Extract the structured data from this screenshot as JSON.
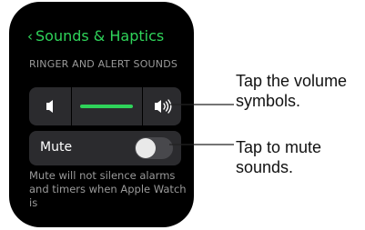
{
  "header": {
    "back_label": "Sounds & Haptics"
  },
  "section": {
    "label": "RINGER AND ALERT SOUNDS"
  },
  "volume": {
    "level": 0.5
  },
  "mute": {
    "label": "Mute",
    "state": "off"
  },
  "footnote": "Mute will not silence alarms and timers when Apple Watch is",
  "callouts": {
    "volume": "Tap the volume symbols.",
    "mute": "Tap to mute sounds."
  },
  "colors": {
    "accent": "#2fd35a",
    "watch_bg": "#000000",
    "cell_bg": "#2b2b2e"
  },
  "icons": {
    "back": "chevron-left-icon",
    "vol_down": "speaker-icon",
    "vol_up": "speaker-wave-icon"
  }
}
